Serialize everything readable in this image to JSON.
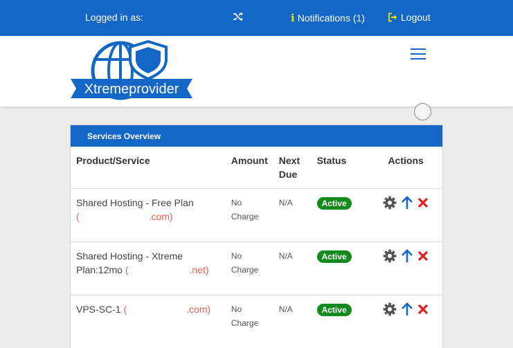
{
  "topbar": {
    "logged_in_label": "Logged in as:",
    "notifications_label": "Notifications (1)",
    "logout_label": "Logout"
  },
  "brand": {
    "logo_text": "Xtremeprovider"
  },
  "services": {
    "title": "Services Overview",
    "columns": [
      "Product/Service",
      "Amount",
      "Next Due",
      "Status",
      "Actions"
    ],
    "columns_split": {
      "next": "Next",
      "due": "Due"
    },
    "rows": [
      {
        "product": "Shared Hosting - Free Plan",
        "domain_open": "(",
        "domain_tld": ".com)",
        "amount_1": "No",
        "amount_2": "Charge",
        "next_due": "N/A",
        "status": "Active"
      },
      {
        "product": "Shared Hosting - Xtreme",
        "product_2": "Plan:12mo",
        "domain_open": "(",
        "domain_tld": ".net)",
        "amount_1": "No",
        "amount_2": "Charge",
        "next_due": "N/A",
        "status": "Active"
      },
      {
        "product": "VPS-SC-1",
        "domain_open": "(",
        "domain_tld": ".com)",
        "amount_1": "No",
        "amount_2": "Charge",
        "next_due": "N/A",
        "status": "Active"
      }
    ]
  },
  "colors": {
    "primary": "#1467c6",
    "active_badge": "#138a1c",
    "domain_text": "#e2604e",
    "cancel_icon": "#e31d1d"
  },
  "icons": [
    "shuffle-icon",
    "info-icon",
    "logout-icon",
    "hamburger-icon",
    "gear-icon",
    "arrow-up-icon",
    "close-icon"
  ]
}
